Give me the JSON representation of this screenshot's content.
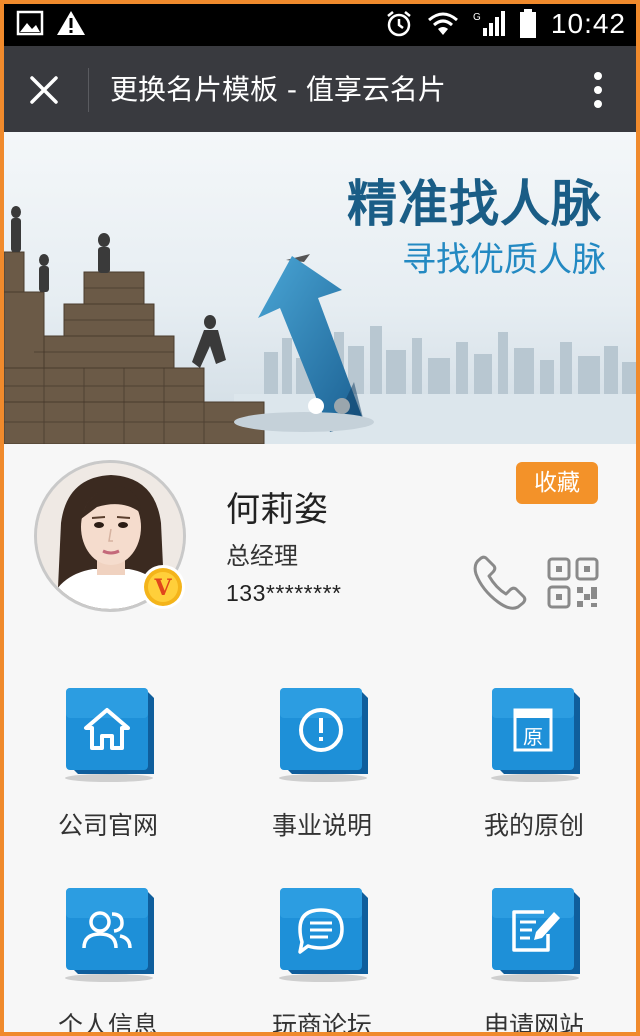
{
  "status_bar": {
    "time": "10:42"
  },
  "title_bar": {
    "title": "更换名片模板 - 值享云名片"
  },
  "banner": {
    "headline": "精准找人脉",
    "subheadline": "寻找优质人脉",
    "slide_count": 2,
    "active_slide": 1
  },
  "profile": {
    "name": "何莉姿",
    "job_title": "总经理",
    "phone": "133********",
    "favorite_label": "收藏",
    "vip_badge_letter": "V"
  },
  "menu": {
    "items": [
      {
        "label": "公司官网",
        "icon": "home-icon"
      },
      {
        "label": "事业说明",
        "icon": "info-icon"
      },
      {
        "label": "我的原创",
        "icon": "original-icon"
      },
      {
        "label": "个人信息",
        "icon": "people-icon"
      },
      {
        "label": "玩商论坛",
        "icon": "chat-icon"
      },
      {
        "label": "申请网站",
        "icon": "edit-icon"
      }
    ]
  },
  "colors": {
    "accent_orange": "#f39229",
    "title_bar": "#393a3f",
    "tile_blue": "#1e90d8",
    "banner_headline": "#1a5d86"
  }
}
